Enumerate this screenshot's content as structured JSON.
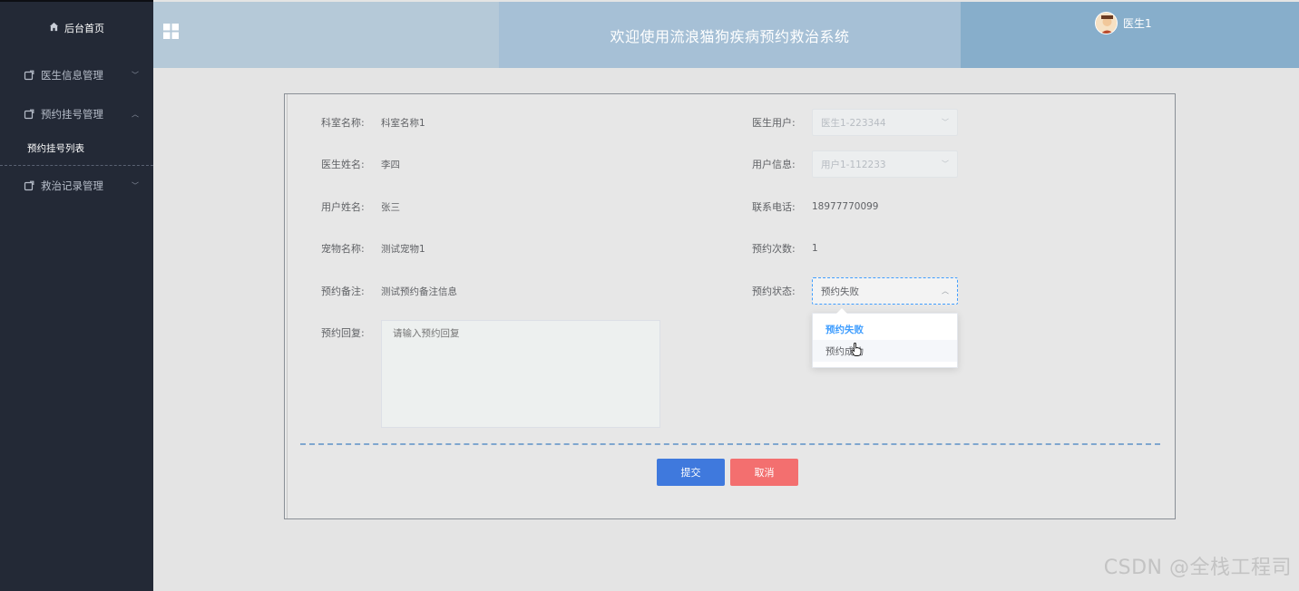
{
  "sidebar": {
    "home_label": "后台首页",
    "menus": [
      {
        "label": "医生信息管理",
        "expanded": false
      },
      {
        "label": "预约挂号管理",
        "expanded": true
      },
      {
        "label": "救治记录管理",
        "expanded": false
      }
    ],
    "submenu": {
      "label": "预约挂号列表"
    }
  },
  "header": {
    "title": "欢迎使用流浪猫狗疾病预约救治系统",
    "user": "医生1"
  },
  "form": {
    "dept_label": "科室名称:",
    "dept_value": "科室名称1",
    "doctor_user_label": "医生用户:",
    "doctor_user_value": "医生1-223344",
    "doctor_name_label": "医生姓名:",
    "doctor_name_value": "李四",
    "user_info_label": "用户信息:",
    "user_info_value": "用户1-112233",
    "user_name_label": "用户姓名:",
    "user_name_value": "张三",
    "phone_label": "联系电话:",
    "phone_value": "18977770099",
    "pet_label": "宠物名称:",
    "pet_value": "测试宠物1",
    "count_label": "预约次数:",
    "count_value": "1",
    "remark_label": "预约备注:",
    "remark_value": "测试预约备注信息",
    "status_label": "预约状态:",
    "status_value": "预约失败",
    "reply_label": "预约回复:",
    "reply_placeholder": "请输入预约回复"
  },
  "status_options": [
    {
      "label": "预约失败",
      "selected": true
    },
    {
      "label": "预约成功",
      "selected": false
    }
  ],
  "buttons": {
    "submit": "提交",
    "cancel": "取消"
  },
  "watermark": "CSDN @全栈工程司",
  "colors": {
    "accent": "#409eff",
    "submit": "#3f79dd",
    "cancel": "#f36f6f",
    "sidebar": "#232936"
  }
}
